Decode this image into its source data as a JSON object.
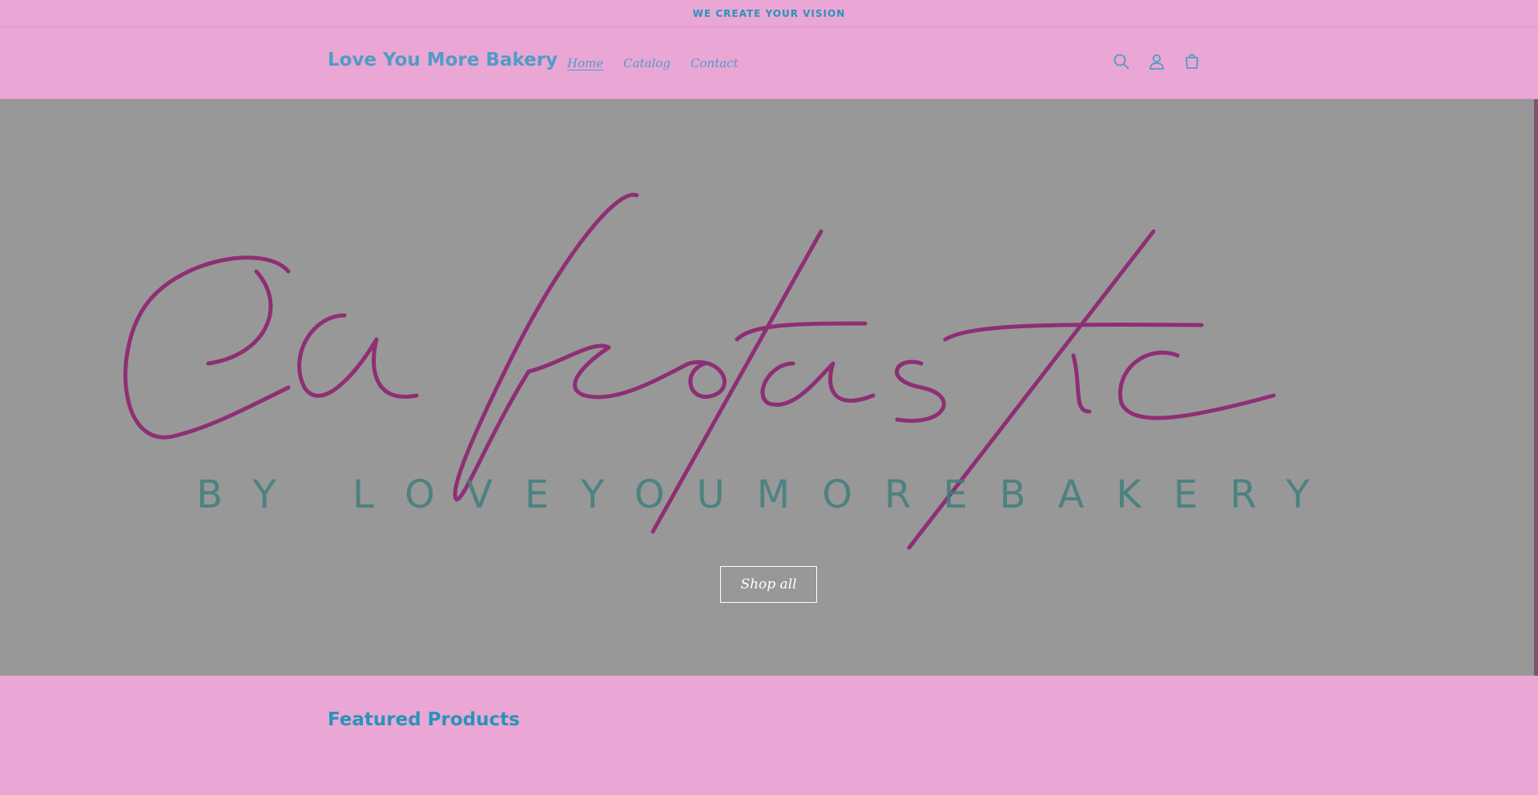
{
  "announcement": {
    "text": "WE CREATE YOUR VISION"
  },
  "header": {
    "logo": "Love You More Bakery",
    "nav": [
      {
        "label": "Home",
        "active": true
      },
      {
        "label": "Catalog",
        "active": false
      },
      {
        "label": "Contact",
        "active": false
      }
    ],
    "icons": [
      "search-icon",
      "account-icon",
      "cart-icon"
    ]
  },
  "hero": {
    "image_text": "Caketastic",
    "image_subtext": "BY LOVEYOUMOREBAKERY",
    "button_label": "Shop all"
  },
  "featured": {
    "title": "Featured Products"
  },
  "colors": {
    "page_bg": "#eaa6d4",
    "accent_text": "#2a93b8",
    "hero_overlay": "#989898",
    "script_magenta": "#8e2a74",
    "subtext_teal": "#3f7f7c"
  }
}
